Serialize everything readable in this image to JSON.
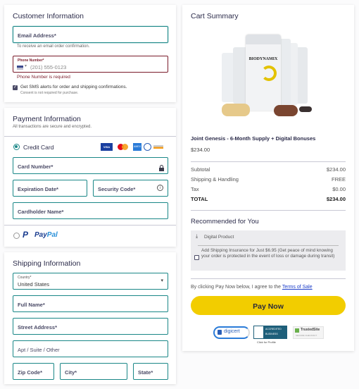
{
  "customer": {
    "title": "Customer Information",
    "email_label": "Email Address*",
    "email_hint": "To receive an email order confirmation.",
    "phone_label": "Phone Number*",
    "phone_placeholder": "(201) 555-0123",
    "phone_error": "Phone Number is required",
    "sms_label": "Get SMS alerts for order and shipping confirmations.",
    "sms_sub": "Consent is not required for purchase.",
    "sms_checked": true
  },
  "payment": {
    "title": "Payment Information",
    "subtitle": "All transactions are secure and encrypted.",
    "credit_card_label": "Credit Card",
    "card_brands": [
      "VISA",
      "Mastercard",
      "AMEX",
      "Diners",
      "Discover"
    ],
    "card_number_label": "Card Number*",
    "expiration_label": "Expiration Date*",
    "security_label": "Security Code*",
    "cardholder_label": "Cardholder Name*",
    "paypal_label_a": "Pay",
    "paypal_label_b": "Pal"
  },
  "shipping": {
    "title": "Shipping Information",
    "country_label": "Country*",
    "country_value": "United States",
    "full_name_label": "Full Name*",
    "street_label": "Street Address*",
    "apt_label": "Apt / Suite / Other",
    "zip_label": "Zip Code*",
    "city_label": "City*",
    "state_label": "State*"
  },
  "cart": {
    "title": "Cart Summary",
    "product_brand": "BIODYNAMIX",
    "product_name": "Joint Genesis - 6-Month Supply + Digital Bonuses",
    "product_price": "$234.00",
    "lines": [
      {
        "label": "Subtotal",
        "value": "$234.00"
      },
      {
        "label": "Shipping & Handling",
        "value": "FREE"
      },
      {
        "label": "Tax",
        "value": "$0.00"
      },
      {
        "label": "TOTAL",
        "value": "$234.00"
      }
    ],
    "recommended_title": "Recommended for You",
    "digital_product_label": "Digital Product",
    "insurance_label": "Add Shipping Insurance for Just $6.95 (Get peace of mind knowing your order is protected in the event of loss or damage during transit)",
    "agree_text": "By clicking Pay Now below, I agree to the ",
    "terms_link": "Terms of Sale",
    "pay_button": "Pay Now",
    "badges": {
      "digicert": "digicert",
      "bbb_a": "ACCREDITED",
      "bbb_b": "BUSINESS",
      "bbb_click": "Click for Profile",
      "trusted": "TrustedSite",
      "trusted_sub": "SECURE CHECKOUT"
    }
  },
  "colors": {
    "accent": "#1a8787",
    "error": "#7a1b2a",
    "pay_button": "#f2cd00"
  }
}
